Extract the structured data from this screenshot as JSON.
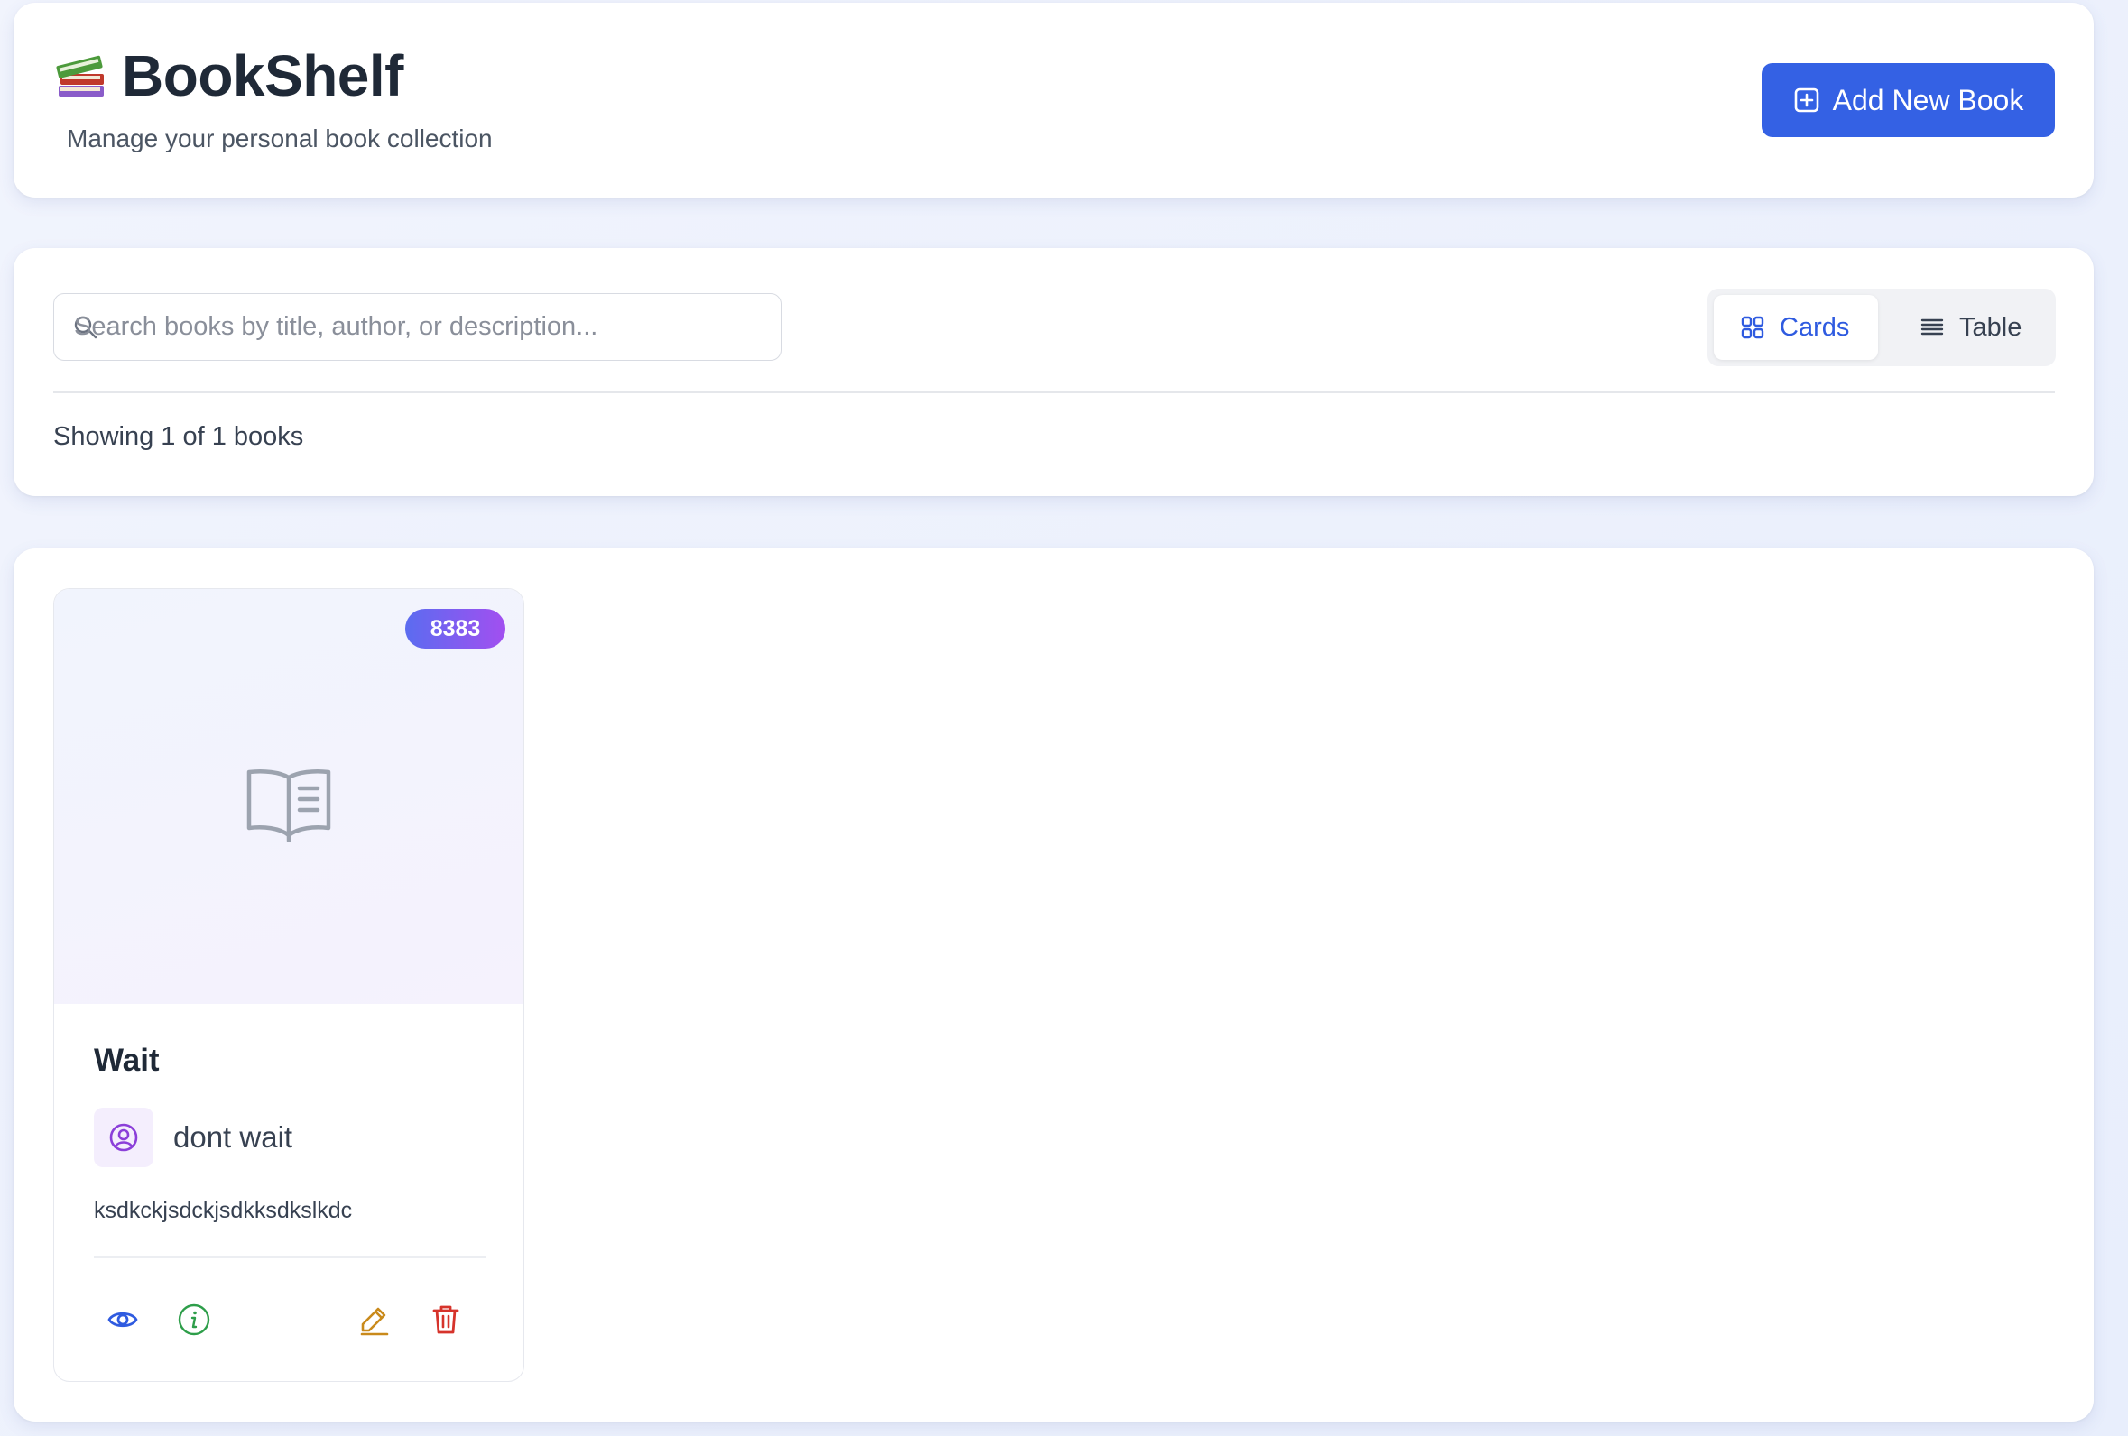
{
  "header": {
    "title": "BookShelf",
    "subtitle": "Manage your personal book collection",
    "logo_icon": "books-icon",
    "add_button_label": "Add New Book",
    "add_button_icon": "plus-square-icon"
  },
  "search": {
    "placeholder": "Search books by title, author, or description...",
    "value": "",
    "icon": "search-icon"
  },
  "view_toggle": {
    "options": [
      {
        "label": "Cards",
        "icon": "grid-icon",
        "active": true
      },
      {
        "label": "Table",
        "icon": "list-icon",
        "active": false
      }
    ]
  },
  "results": {
    "count_text": "Showing 1 of 1 books"
  },
  "books": [
    {
      "id_badge": "8383",
      "title": "Wait",
      "author": "dont wait",
      "description": "ksdkckjsdckjsdkksdkslkdc",
      "cover_icon": "open-book-icon",
      "author_icon": "user-circle-icon",
      "actions": [
        {
          "name": "view",
          "icon": "eye-icon",
          "color": "#2f5be0"
        },
        {
          "name": "details",
          "icon": "info-icon",
          "color": "#2e9e4a"
        },
        {
          "name": "edit",
          "icon": "pencil-icon",
          "color": "#c98a1b"
        },
        {
          "name": "delete",
          "icon": "trash-icon",
          "color": "#d6332b"
        }
      ]
    }
  ],
  "colors": {
    "accent": "#3461e4",
    "badge_gradient_start": "#5b6cf0",
    "badge_gradient_end": "#a24ff0",
    "author_icon": "#8b3fd9"
  }
}
